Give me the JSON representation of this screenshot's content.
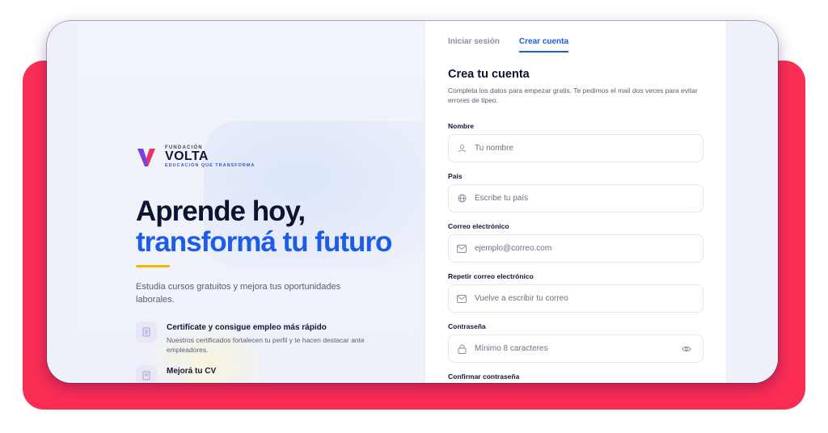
{
  "brand": {
    "top": "FUNDACIÓN",
    "name": "VOLTA",
    "tagline": "EDUCACIÓN QUE TRANSFORMA"
  },
  "hero": {
    "line1": "Aprende hoy,",
    "line2": "transformá tu futuro",
    "intro": "Estudia cursos gratuitos y mejora tus oportunidades laborales."
  },
  "features": [
    {
      "title": "Certifícate y consigue empleo más rápido",
      "desc": "Nuestros certificados fortalecen tu perfil y te hacen destacar ante empleadores.",
      "icon": "certificate-icon"
    },
    {
      "title": "Mejorá tu CV",
      "desc": "",
      "icon": "document-icon"
    }
  ],
  "tabs": [
    {
      "label": "Iniciar sesión",
      "active": false
    },
    {
      "label": "Crear cuenta",
      "active": true
    }
  ],
  "form": {
    "title": "Crea tu cuenta",
    "subtitle": "Completa los datos para empezar gratis. Te pedimos el mail dos veces para evitar errores de tipeo.",
    "fields": [
      {
        "label": "Nombre",
        "placeholder": "Tu nombre",
        "icon": "user-icon"
      },
      {
        "label": "País",
        "placeholder": "Escribe tu país",
        "icon": "globe-icon"
      },
      {
        "label": "Correo electrónico",
        "placeholder": "ejemplo@correo.com",
        "icon": "mail-icon"
      },
      {
        "label": "Repetir correo electrónico",
        "placeholder": "Vuelve a escribir tu correo",
        "icon": "mail-icon"
      },
      {
        "label": "Contraseña",
        "placeholder": "Mínimo 8 caracteres",
        "icon": "lock-icon"
      },
      {
        "label": "Confirmar contraseña"
      }
    ]
  },
  "colors": {
    "accent": "#1d5be8",
    "backdrop": "#fb2d55",
    "highlight": "#f5b400"
  }
}
